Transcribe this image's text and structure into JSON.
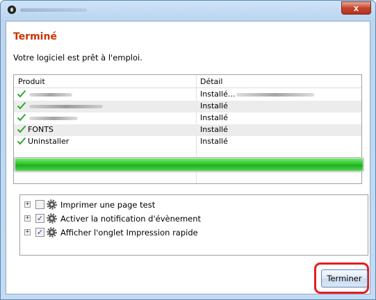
{
  "window": {
    "close_glyph": "x"
  },
  "page": {
    "heading": "Terminé",
    "subtitle": "Votre logiciel est prêt à l'emploi."
  },
  "table": {
    "headers": [
      "Produit",
      "Détail"
    ],
    "rows": [
      {
        "product": "",
        "detail": "Installé..."
      },
      {
        "product": "",
        "detail": "Installé"
      },
      {
        "product": "",
        "detail": "Installé"
      },
      {
        "product": "FONTS",
        "detail": "Installé"
      },
      {
        "product": "Uninstaller",
        "detail": "Installé"
      }
    ]
  },
  "progress": {
    "value_percent": 100,
    "color": "#2bc62a"
  },
  "options": [
    {
      "label": "Imprimer une page test",
      "checked": false,
      "expander": "+"
    },
    {
      "label": "Activer la notification d'évènement",
      "checked": true,
      "expander": "+"
    },
    {
      "label": "Afficher l'onglet Impression rapide",
      "checked": true,
      "expander": "+"
    }
  ],
  "buttons": {
    "finish": "Terminer"
  },
  "colors": {
    "heading": "#cc3300",
    "highlight": "#e21d22"
  }
}
